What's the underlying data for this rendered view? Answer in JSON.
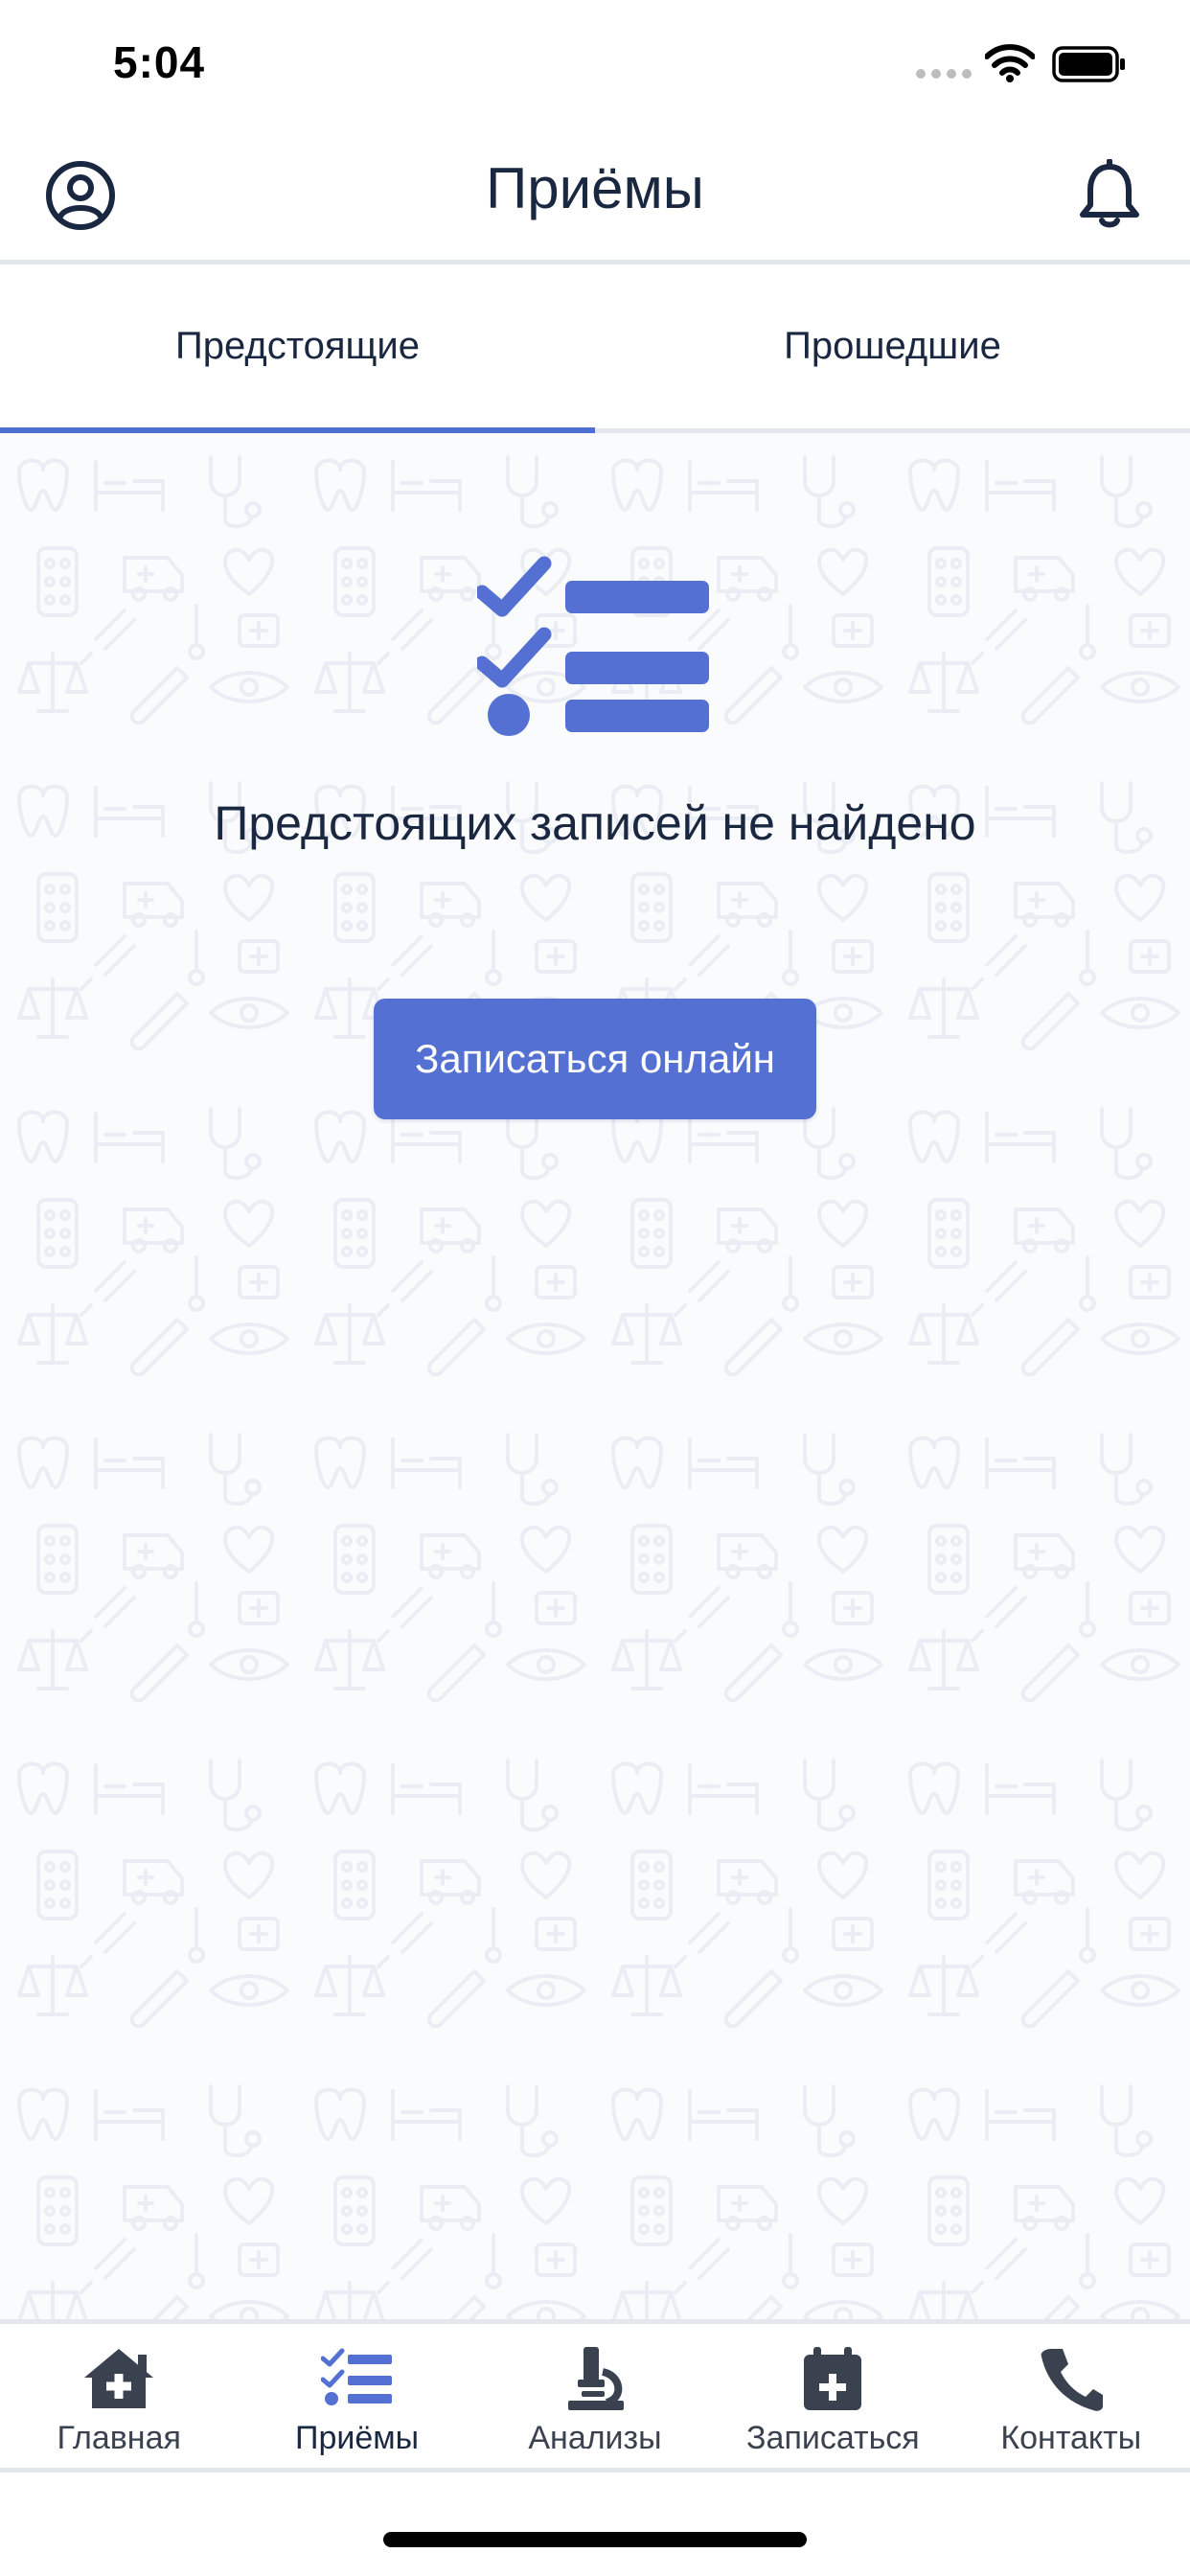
{
  "status_bar": {
    "time": "5:04"
  },
  "header": {
    "title": "Приёмы"
  },
  "tabs": [
    {
      "label": "Предстоящие",
      "active": true
    },
    {
      "label": "Прошедшие",
      "active": false
    }
  ],
  "empty_state": {
    "message": "Предстоящих записей не найдено",
    "button_label": "Записаться онлайн"
  },
  "bottom_nav": [
    {
      "label": "Главная",
      "icon": "home-medical-icon",
      "active": false
    },
    {
      "label": "Приёмы",
      "icon": "checklist-icon",
      "active": true
    },
    {
      "label": "Анализы",
      "icon": "microscope-icon",
      "active": false
    },
    {
      "label": "Записаться",
      "icon": "calendar-plus-icon",
      "active": false
    },
    {
      "label": "Контакты",
      "icon": "phone-icon",
      "active": false
    }
  ],
  "colors": {
    "accent": "#5470d2",
    "text": "#1a2740",
    "nav_inactive": "#3a4250",
    "divider": "#e3e8ef"
  }
}
